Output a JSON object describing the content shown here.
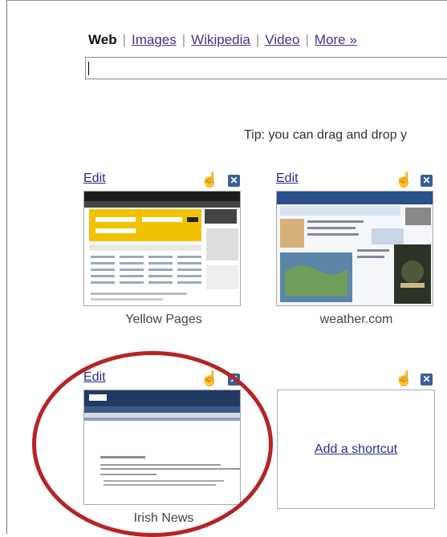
{
  "tabs": [
    {
      "label": "Web",
      "active": true
    },
    {
      "label": "Images",
      "active": false
    },
    {
      "label": "Wikipedia",
      "active": false
    },
    {
      "label": "Video",
      "active": false
    },
    {
      "label": "More »",
      "active": false
    }
  ],
  "search": {
    "value": "",
    "placeholder": ""
  },
  "tip": "Tip: you can drag and drop y",
  "tiles": [
    {
      "edit": "Edit",
      "caption": "Yellow Pages"
    },
    {
      "edit": "Edit",
      "caption": "weather.com"
    },
    {
      "edit": "Edit",
      "caption": "Irish News"
    },
    {
      "add_label": "Add a shortcut"
    }
  ],
  "icons": {
    "drag": "hand-icon",
    "close": "close-icon"
  },
  "colors": {
    "highlight_ellipse": "#b52426",
    "close_button": "#3b5e99",
    "link": "#4b2d8f"
  }
}
